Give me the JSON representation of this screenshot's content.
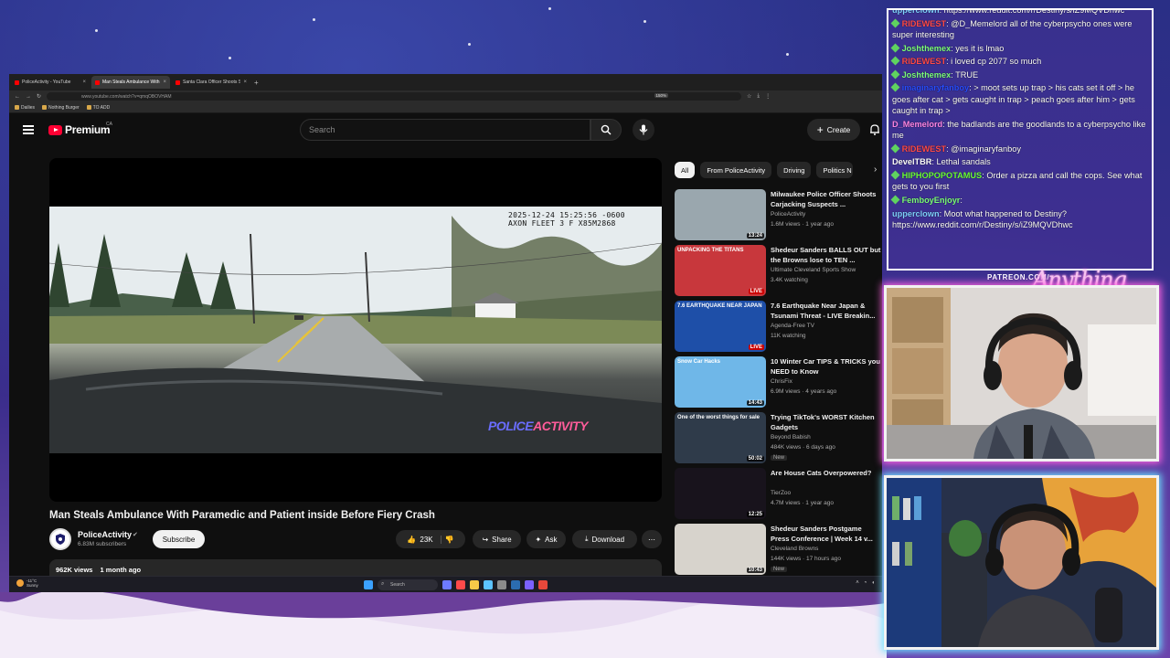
{
  "browser": {
    "tabs": [
      {
        "label": "PoliceActivity - YouTube",
        "active": false
      },
      {
        "label": "Man Steals Ambulance With Pa",
        "active": true
      },
      {
        "label": "Santa Clara Officer Shoots Susp",
        "active": false
      }
    ],
    "url": "www.youtube.com/watch?v=qmqOBOVHAM",
    "zoom": "150%",
    "bookmarks": [
      "Dailies",
      "Nothing Burger",
      "TO ADD"
    ]
  },
  "youtube": {
    "logo_text": "Premium",
    "region": "CA",
    "search_placeholder": "Search",
    "create_label": "Create",
    "video": {
      "timestamp_line1": "2025-12-24 15:25:56 -0600",
      "timestamp_line2": "AXON FLEET 3 F X85M2868",
      "watermark_a": "POLICE",
      "watermark_b": "ACTIVITY",
      "title": "Man Steals Ambulance With Paramedic and Patient inside Before Fiery Crash"
    },
    "channel": {
      "name": "PoliceActivity",
      "subscribers": "6.83M subscribers",
      "subscribe_label": "Subscribe"
    },
    "actions": {
      "likes": "23K",
      "share": "Share",
      "ask": "Ask",
      "download": "Download"
    },
    "description": {
      "views": "962K views",
      "age": "1 month ago"
    },
    "chips": [
      "All",
      "From PoliceActivity",
      "Driving",
      "Politics N"
    ],
    "recommendations": [
      {
        "title": "Milwaukee Police Officer Shoots Carjacking Suspects ...",
        "channel": "PoliceActivity",
        "meta": "1.6M views · 1 year ago",
        "badge": "13:24",
        "live": false,
        "new": "",
        "thumb_color": "#9aa7ae",
        "thumb_text": ""
      },
      {
        "title": "Shedeur Sanders BALLS OUT but the Browns lose to TEN ...",
        "channel": "Ultimate Cleveland Sports Show",
        "meta": "3.4K watching",
        "badge": "LIVE",
        "live": true,
        "new": "",
        "thumb_color": "#c8373c",
        "thumb_text": "UNPACKING THE TITANS"
      },
      {
        "title": "7.6 Earthquake Near Japan & Tsunami Threat - LIVE Breakin...",
        "channel": "Agenda-Free TV",
        "meta": "11K watching",
        "badge": "LIVE",
        "live": true,
        "new": "",
        "thumb_color": "#1e4fa8",
        "thumb_text": "7.6 EARTHQUAKE NEAR JAPAN"
      },
      {
        "title": "10 Winter Car TIPS & TRICKS you NEED to Know",
        "channel": "ChrisFix",
        "meta": "6.9M views · 4 years ago",
        "badge": "14:43",
        "live": false,
        "new": "",
        "thumb_color": "#6fb7e8",
        "thumb_text": "Snow Car Hacks"
      },
      {
        "title": "Trying TikTok's WORST Kitchen Gadgets",
        "channel": "Beyond Babish",
        "meta": "484K views · 6 days ago",
        "badge": "50:02",
        "live": false,
        "new": "New",
        "thumb_color": "#2f3b4a",
        "thumb_text": "One of the worst things for sale"
      },
      {
        "title": "Are House Cats Overpowered?",
        "channel": "TierZoo",
        "meta": "4.7M views · 1 year ago",
        "badge": "12:25",
        "live": false,
        "new": "",
        "thumb_color": "#18131c",
        "thumb_text": ""
      },
      {
        "title": "Shedeur Sanders Postgame Press Conference | Week 14 v...",
        "channel": "Cleveland Browns",
        "meta": "144K views · 17 hours ago",
        "badge": "10:43",
        "live": false,
        "new": "New",
        "thumb_color": "#d7d3cc",
        "thumb_text": ""
      }
    ]
  },
  "taskbar": {
    "weather_temp": "-11°C",
    "weather_desc": "Sunny",
    "search_label": "Search"
  },
  "chat": {
    "messages": [
      {
        "user": "upperclown",
        "text": "https://www.reddit.com/r/Destiny/s/iZ9MQVDhwc",
        "color": "#7fd0ff",
        "badge": false
      },
      {
        "user": "RIDEWEST",
        "text": "@D_Memelord all of the cyberpsycho ones were super interesting",
        "color": "#ff4a4a",
        "badge": true
      },
      {
        "user": "Joshthemex",
        "text": "yes it is lmao",
        "color": "#7dff7d",
        "badge": true
      },
      {
        "user": "RIDEWEST",
        "text": "i loved cp 2077 so much",
        "color": "#ff4a4a",
        "badge": true
      },
      {
        "user": "Joshthemex",
        "text": "TRUE",
        "color": "#7dff7d",
        "badge": true
      },
      {
        "user": "imaginaryfanboy",
        "text": "> moot sets up trap > his cats set it off > he goes after cat > gets caught in trap > peach goes after him > gets caught in trap >",
        "color": "#2a4dff",
        "badge": true
      },
      {
        "user": "D_Memelord",
        "text": "the badlands are the goodlands to a cyberpsycho like me",
        "color": "#ff86e8",
        "badge": false
      },
      {
        "user": "RIDEWEST",
        "text": "@imaginaryfanboy",
        "color": "#ff4a4a",
        "badge": true
      },
      {
        "user": "DevelTBR",
        "text": "Lethal sandals",
        "color": "#ffffff",
        "badge": false
      },
      {
        "user": "HIPHOPOPOTAMUS",
        "text": "Order a pizza and call the cops. See what gets to you first",
        "color": "#6cff3a",
        "badge": true
      },
      {
        "user": "FemboyEnjoyr",
        "text": "",
        "color": "#7dff7d",
        "badge": true
      },
      {
        "user": "upperclown",
        "text": "Moot what happened to Destiny? https://www.reddit.com/r/Destiny/s/iZ9MQVDhwc",
        "color": "#7fd0ff",
        "badge": false
      }
    ]
  },
  "overlay": {
    "patreon": "PATREON.COM/",
    "logo": "Anything Goes"
  },
  "colors": {
    "youtube_red": "#ff0033",
    "cam_top_glow": "#ff65e0",
    "cam_bottom_glow": "#6ee4ff"
  }
}
